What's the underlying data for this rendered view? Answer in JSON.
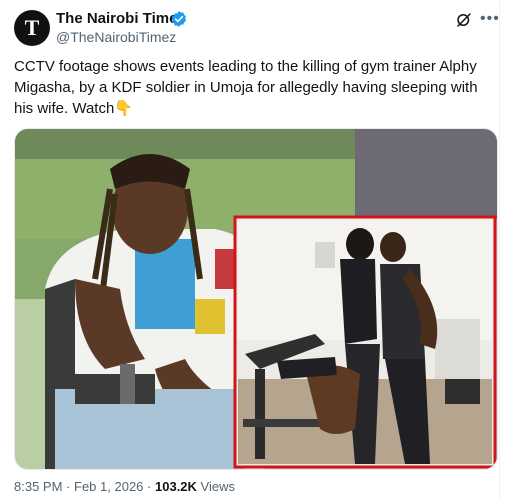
{
  "author": {
    "name": "The Nairobi Times",
    "handle": "@TheNairobiTimez",
    "avatar_letter": "T",
    "verified": true
  },
  "icons": {
    "verified": "verified-badge-icon",
    "grok": "grok-icon",
    "more": "more-icon"
  },
  "tweet": {
    "text": "CCTV footage shows events leading to the killing of gym trainer Alphy Migasha, by a KDF soldier in Umoja for allegedly having sleeping with his wife. Watch",
    "emoji": "👇"
  },
  "footer": {
    "time": "8:35 PM",
    "sep": "·",
    "date": "Feb 1, 2026",
    "views_count": "103.2K",
    "views_label": "Views"
  },
  "colors": {
    "accent": "#1d9bf0",
    "muted": "#536471",
    "highlight_border": "#d0161c"
  }
}
